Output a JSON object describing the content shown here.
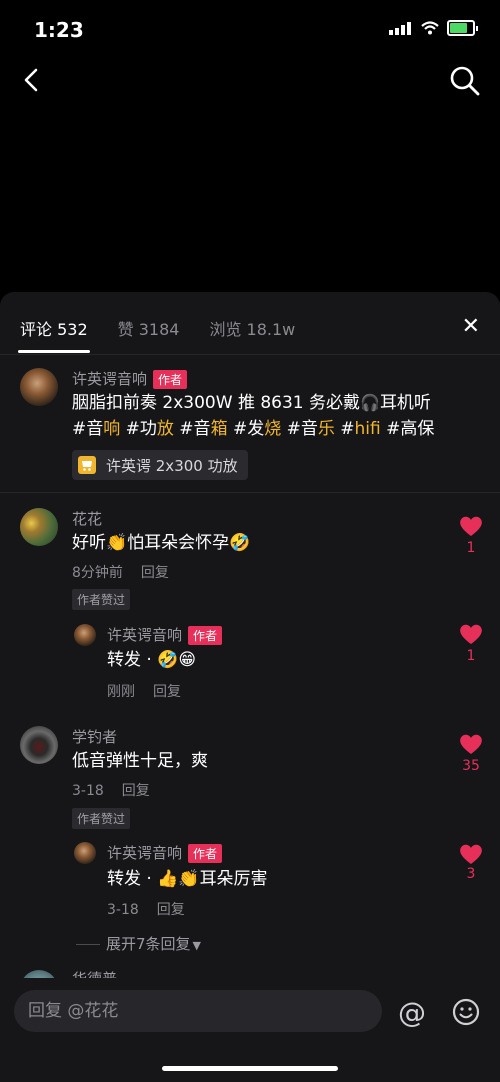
{
  "status": {
    "time": "1:23"
  },
  "tabs": [
    {
      "label": "评论 532"
    },
    {
      "label": "赞 3184"
    },
    {
      "label": "浏览 18.1w"
    }
  ],
  "post": {
    "author": "许英谔音响",
    "badge": "作者",
    "line1": "胭脂扣前奏 2x300W 推 8631 务必戴",
    "line1_tail": "耳机听",
    "tags": [
      {
        "p": "#音",
        "h": "响"
      },
      {
        "p": " #功",
        "h": "放"
      },
      {
        "p": " #音",
        "h": "箱"
      },
      {
        "p": " #发",
        "h": "烧"
      },
      {
        "p": " #音",
        "h": "乐"
      },
      {
        "p": " #",
        "h": "hifi"
      },
      {
        "p": " #高保",
        "h": ""
      }
    ],
    "product": "许英谔 2x300 功放"
  },
  "comments": [
    {
      "name": "花花",
      "text": "好听",
      "text_tail": "怕耳朵会怀孕",
      "time": "8分钟前",
      "reply": "回复",
      "liked_by_author": "作者赞过",
      "likes": "1"
    },
    {
      "name": "许英谔音响",
      "badge": "作者",
      "text": "转发 · ",
      "time": "刚刚",
      "reply": "回复",
      "likes": "1"
    },
    {
      "name": "学钓者",
      "text": "低音弹性十足，爽",
      "time": "3-18",
      "reply": "回复",
      "liked_by_author": "作者赞过",
      "likes": "35"
    },
    {
      "name": "许英谔音响",
      "badge": "作者",
      "text": "转发 · ",
      "text_tail": "耳朵厉害",
      "time": "3-18",
      "reply": "回复",
      "likes": "3"
    }
  ],
  "expand_label": "展开7条回复",
  "partial_name": "华德普",
  "reply_input": {
    "placeholder": "回复 @花花"
  },
  "icons": [
    "back-icon",
    "search-icon",
    "close-icon",
    "heart-icon",
    "cart-icon",
    "at-icon",
    "emoji-icon"
  ],
  "colors": {
    "accent": "#e6305a",
    "tag": "#f2b52e",
    "sheet": "#161619"
  }
}
